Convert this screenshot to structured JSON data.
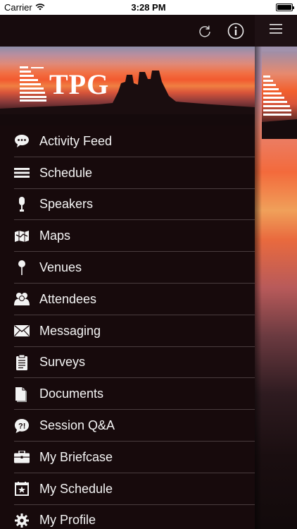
{
  "status_bar": {
    "carrier": "Carrier",
    "time": "3:28 PM"
  },
  "banner": {
    "logo_text": "TPG"
  },
  "menu": {
    "items": [
      {
        "label": "Activity Feed",
        "icon": "speech-bubble-icon"
      },
      {
        "label": "Schedule",
        "icon": "lines-icon"
      },
      {
        "label": "Speakers",
        "icon": "microphone-icon"
      },
      {
        "label": "Maps",
        "icon": "map-icon"
      },
      {
        "label": "Venues",
        "icon": "pin-icon"
      },
      {
        "label": "Attendees",
        "icon": "people-icon"
      },
      {
        "label": "Messaging",
        "icon": "envelope-icon"
      },
      {
        "label": "Surveys",
        "icon": "clipboard-icon"
      },
      {
        "label": "Documents",
        "icon": "documents-icon"
      },
      {
        "label": "Session Q&A",
        "icon": "question-bubble-icon"
      },
      {
        "label": "My Briefcase",
        "icon": "briefcase-icon"
      },
      {
        "label": "My Schedule",
        "icon": "star-calendar-icon"
      },
      {
        "label": "My Profile",
        "icon": "gear-icon"
      }
    ]
  }
}
